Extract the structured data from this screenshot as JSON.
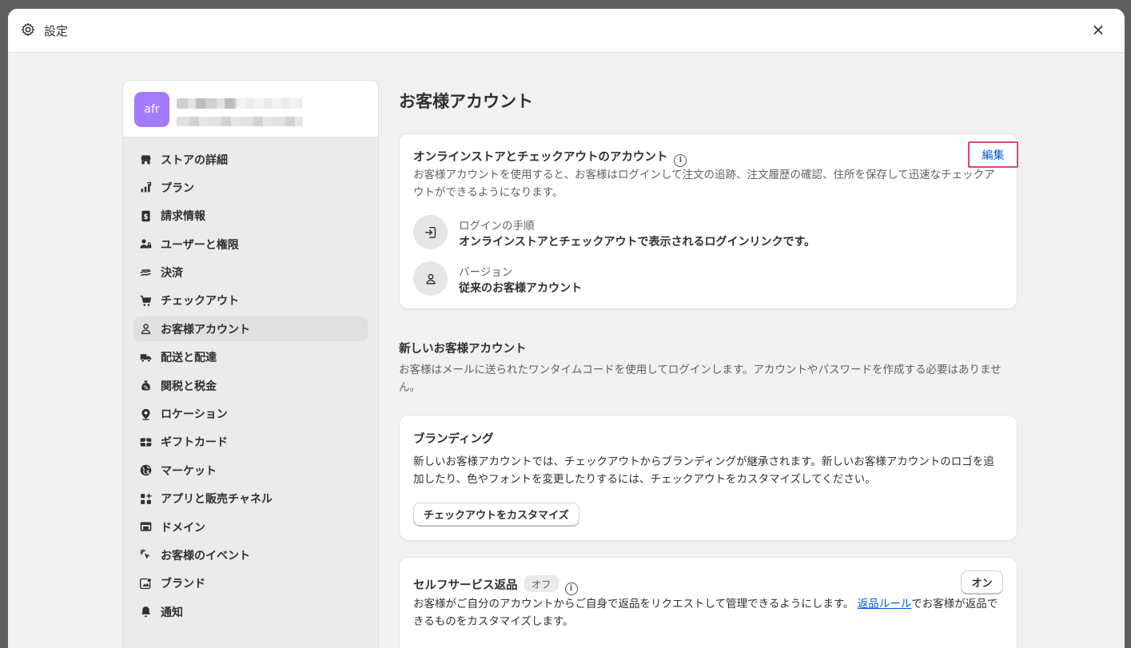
{
  "header": {
    "title": "設定",
    "close_label": "×"
  },
  "store": {
    "avatar_text": "afr"
  },
  "sidebar": {
    "items": [
      {
        "label": "ストアの詳細",
        "icon": "store-icon"
      },
      {
        "label": "プラン",
        "icon": "plan-icon"
      },
      {
        "label": "請求情報",
        "icon": "billing-icon"
      },
      {
        "label": "ユーザーと権限",
        "icon": "users-icon"
      },
      {
        "label": "決済",
        "icon": "payments-icon"
      },
      {
        "label": "チェックアウト",
        "icon": "cart-icon"
      },
      {
        "label": "お客様アカウント",
        "icon": "person-icon",
        "active": true
      },
      {
        "label": "配送と配達",
        "icon": "truck-icon"
      },
      {
        "label": "関税と税金",
        "icon": "tax-icon"
      },
      {
        "label": "ロケーション",
        "icon": "location-icon"
      },
      {
        "label": "ギフトカード",
        "icon": "gift-card-icon"
      },
      {
        "label": "マーケット",
        "icon": "globe-icon"
      },
      {
        "label": "アプリと販売チャネル",
        "icon": "apps-icon"
      },
      {
        "label": "ドメイン",
        "icon": "domain-icon"
      },
      {
        "label": "お客様のイベント",
        "icon": "cursor-icon"
      },
      {
        "label": "ブランド",
        "icon": "brand-icon"
      },
      {
        "label": "通知",
        "icon": "bell-icon"
      }
    ]
  },
  "main": {
    "title": "お客様アカウント",
    "accounts_card": {
      "title": "オンラインストアとチェックアウトのアカウント",
      "edit_label": "編集",
      "description": "お客様アカウントを使用すると、お客様はログインして注文の追跡、注文履歴の確認、住所を保存して迅速なチェックアウトができるようになります。",
      "login_label": "ログインの手順",
      "login_value": "オンラインストアとチェックアウトで表示されるログインリンクです。",
      "version_label": "バージョン",
      "version_value": "従来のお客様アカウント"
    },
    "new_accounts": {
      "title": "新しいお客様アカウント",
      "description": "お客様はメールに送られたワンタイムコードを使用してログインします。アカウントやパスワードを作成する必要はありません。"
    },
    "branding_card": {
      "title": "ブランディング",
      "description": "新しいお客様アカウントでは、チェックアウトからブランディングが継承されます。新しいお客様アカウントのロゴを追加したり、色やフォントを変更したりするには、チェックアウトをカスタマイズしてください。",
      "button_label": "チェックアウトをカスタマイズ"
    },
    "returns_card": {
      "title": "セルフサービス返品",
      "status_badge": "オフ",
      "on_button": "オン",
      "description_before": "お客様がご自分のアカウントからご自身で返品をリクエストして管理できるようにします。",
      "link_text": "返品ルール",
      "description_after": "でお客様が返品できるものをカスタマイズします。"
    }
  }
}
